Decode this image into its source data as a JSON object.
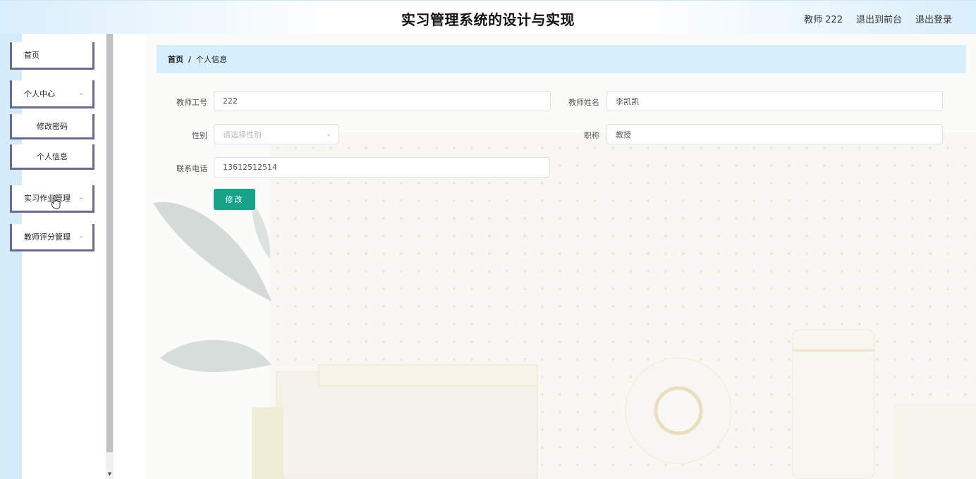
{
  "header": {
    "title": "实习管理系统的设计与实现",
    "user_label": "教师 222",
    "back_to_front": "退出到前台",
    "logout": "退出登录"
  },
  "sidebar": {
    "items": [
      {
        "label": "首页"
      },
      {
        "label": "个人中心",
        "icon": "chevron-down-icon"
      },
      {
        "label": "修改密码"
      },
      {
        "label": "个人信息"
      },
      {
        "label": "实习作业管理",
        "icon": "chevron-down-icon"
      },
      {
        "label": "教师评分管理",
        "icon": "chevron-down-icon"
      }
    ]
  },
  "breadcrumb": {
    "home": "首页",
    "separator": "/",
    "current": "个人信息"
  },
  "form": {
    "teacher_id_label": "教师工号",
    "teacher_id_value": "222",
    "teacher_name_label": "教师姓名",
    "teacher_name_value": "李凯凯",
    "gender_label": "性别",
    "gender_placeholder": "请选择性别",
    "title_label": "职称",
    "title_value": "教授",
    "phone_label": "联系电话",
    "phone_value": "13612512514",
    "submit_label": "修改"
  },
  "colors": {
    "accent_button": "#16a388",
    "breadcrumb_bg": "#d7effc",
    "menu_border": "#6c6a93",
    "side_strip": "#d4ecfa"
  }
}
